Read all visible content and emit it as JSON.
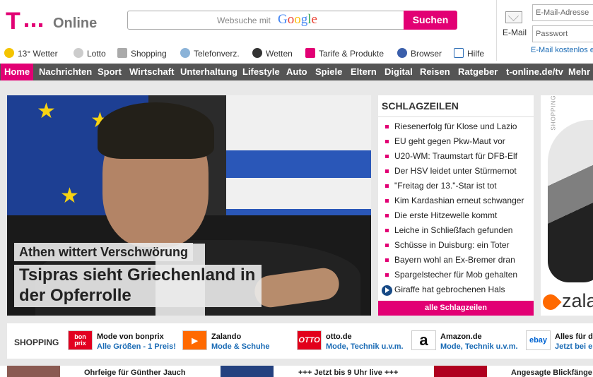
{
  "brand": {
    "primary": "#e20074",
    "t_letter": "T",
    "name": "Online"
  },
  "search": {
    "placeholder": "Websuche mit",
    "provider": "Google",
    "button": "Suchen"
  },
  "login": {
    "mail_label": "E-Mail",
    "email_placeholder": "E-Mail-Adresse",
    "password_placeholder": "Passwort",
    "register_link": "E-Mail kostenlos e"
  },
  "utility": [
    {
      "icon": "weather-icon",
      "label": "13° Wetter"
    },
    {
      "icon": "lotto-icon",
      "label": "Lotto"
    },
    {
      "icon": "shopping-cart-icon",
      "label": "Shopping"
    },
    {
      "icon": "phonebook-icon",
      "label": "Telefonverz."
    },
    {
      "icon": "soccer-ball-icon",
      "label": "Wetten"
    },
    {
      "icon": "tariff-icon",
      "label": "Tarife & Produkte"
    },
    {
      "icon": "browser-icon",
      "label": "Browser"
    },
    {
      "icon": "help-icon",
      "label": "Hilfe"
    }
  ],
  "nav": [
    "Home",
    "Nachrichten",
    "Sport",
    "Wirtschaft",
    "Unterhaltung",
    "Lifestyle",
    "Auto",
    "Spiele",
    "Eltern",
    "Digital",
    "Reisen",
    "Ratgeber",
    "t-online.de/tv",
    "Mehr"
  ],
  "hero": {
    "kicker": "Athen wittert Verschwörung",
    "headline": "Tsipras sieht Griechenland in der Opferrolle"
  },
  "schlagzeilen": {
    "title": "SCHLAGZEILEN",
    "items": [
      "Riesenerfolg für Klose und Lazio",
      "EU geht gegen Pkw-Maut vor",
      "U20-WM: Traumstart für DFB-Elf",
      "Der HSV leidet unter Stürmernot",
      "\"Freitag der 13.\"-Star ist tot",
      "Kim Kardashian erneut schwanger",
      "Die erste Hitzewelle kommt",
      "Leiche in Schließfach gefunden",
      "Schüsse in Duisburg: ein Toter",
      "Bayern wohl an Ex-Bremer dran",
      "Spargelstecher für Mob gehalten",
      "Giraffe hat gebrochenen Hals"
    ],
    "all_button": "alle Schlagzeilen"
  },
  "ad": {
    "label": "SHOPPING",
    "brand": "zala"
  },
  "shopping": {
    "title": "SHOPPING",
    "entries": [
      {
        "logo": "bon prix",
        "name": "Mode von bonprix",
        "desc": "Alle Größen - 1 Preis!"
      },
      {
        "logo": "▶",
        "name": "Zalando",
        "desc": "Mode & Schuhe"
      },
      {
        "logo": "OTTO",
        "name": "otto.de",
        "desc": "Mode, Technik u.v.m."
      },
      {
        "logo": "a",
        "name": "Amazon.de",
        "desc": "Mode, Technik u.v.m."
      },
      {
        "logo": "ebay",
        "name": "Alles für d",
        "desc": "Jetzt bei e"
      }
    ]
  },
  "bottom": [
    "Ohrfeige für Günther Jauch",
    "+++ Jetzt bis 9 Uhr live +++",
    "Angesagte Blickfänge"
  ]
}
